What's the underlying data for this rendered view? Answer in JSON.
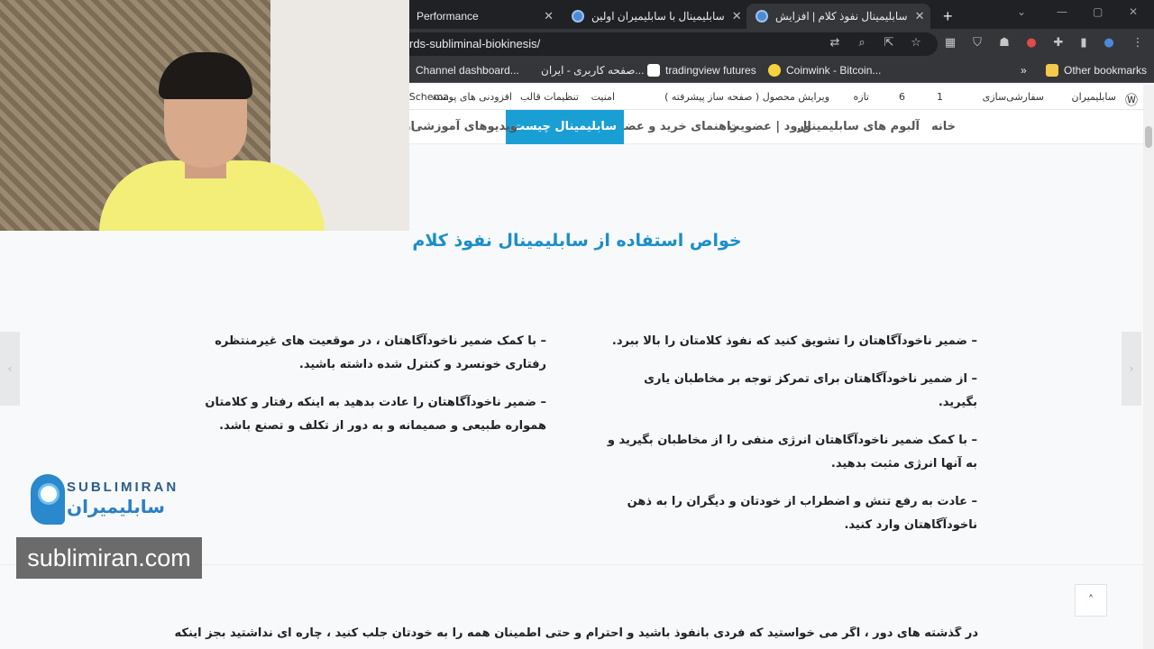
{
  "browser": {
    "tabs": [
      {
        "title": "Performance"
      },
      {
        "title": "سابلیمینال با سابلیمیران اولین"
      },
      {
        "title": "سابلیمینال نفوذ کلام | افزایش"
      }
    ],
    "new_tab": "+",
    "url": "rds-subliminal-biokinesis/",
    "bookmarks": [
      {
        "label": "Channel dashboard..."
      },
      {
        "label": "صفحه کاربری - ایران..."
      },
      {
        "label": "tradingview futures"
      },
      {
        "label": "Coinwink - Bitcoin..."
      },
      {
        "label": "»"
      },
      {
        "label": "Other bookmarks"
      }
    ]
  },
  "wpbar": {
    "items": [
      {
        "label": "سابلیمیران"
      },
      {
        "label": "سفارشی‌سازی"
      },
      {
        "label": "1"
      },
      {
        "label": "6"
      },
      {
        "label": "تازه"
      },
      {
        "label": "ویرایش محصول ( صفحه ساز پیشرفته )"
      },
      {
        "label": "امنیت"
      },
      {
        "label": "تنظیمات قالب"
      },
      {
        "label": "افزودنی های پوسته"
      },
      {
        "label": "st Schema"
      }
    ]
  },
  "nav": {
    "items": [
      {
        "label": "خانه"
      },
      {
        "label": "آلبوم های سابلیمینال"
      },
      {
        "label": "ورود | عضویت"
      },
      {
        "label": "راهنمای خرید و عضویت"
      },
      {
        "label": "سابلیمینال چیست"
      },
      {
        "label": "ویدیوهای آموزشی"
      },
      {
        "label": "ار"
      }
    ]
  },
  "content": {
    "heading": "خواص استفاده از سابلیمینال نفوذ کلام",
    "right_col": [
      "– ضمیر ناخودآگاهتان را تشویق کنید که نفوذ کلامتان را بالا ببرد.",
      "– از ضمیر ناخودآگاهتان برای تمرکز توجه بر مخاطبان یاری بگیرید.",
      "– با کمک ضمیر ناخودآگاهتان انرژی منفی را از مخاطبان بگیرید و به آنها انرژی مثبت بدهید.",
      "– عادت به رفع تنش و اضطراب از خودتان و دیگران را به ذهن ناخودآگاهتان وارد کنید."
    ],
    "left_col": [
      "– با کمک ضمیر ناخودآگاهتان ، در موقعیت های غیرمنتظره رفتاری خونسرد و کنترل شده داشته باشید.",
      "– ضمیر ناخودآگاهتان را عادت بدهید به اینکه رفتار و کلامتان همواره طبیعی و صمیمانه و به دور از تکلف و تصنع باشد."
    ],
    "footer_text": "در گذشته های دور ، اگر می خواستید که فردی بانفوذ باشید و احترام و حتی اطمینان همه را به خودتان جلب کنید ، چاره ای نداشتید بجز اینکه ارتشی قدرتمند درست کنید و در",
    "scroll_top": "˄",
    "left_arrow": "‹",
    "right_arrow": "›"
  },
  "logo": {
    "en": "SUBLIMIRAN",
    "fa": "سابلیمیران"
  },
  "watermark": "sublimiran.com"
}
